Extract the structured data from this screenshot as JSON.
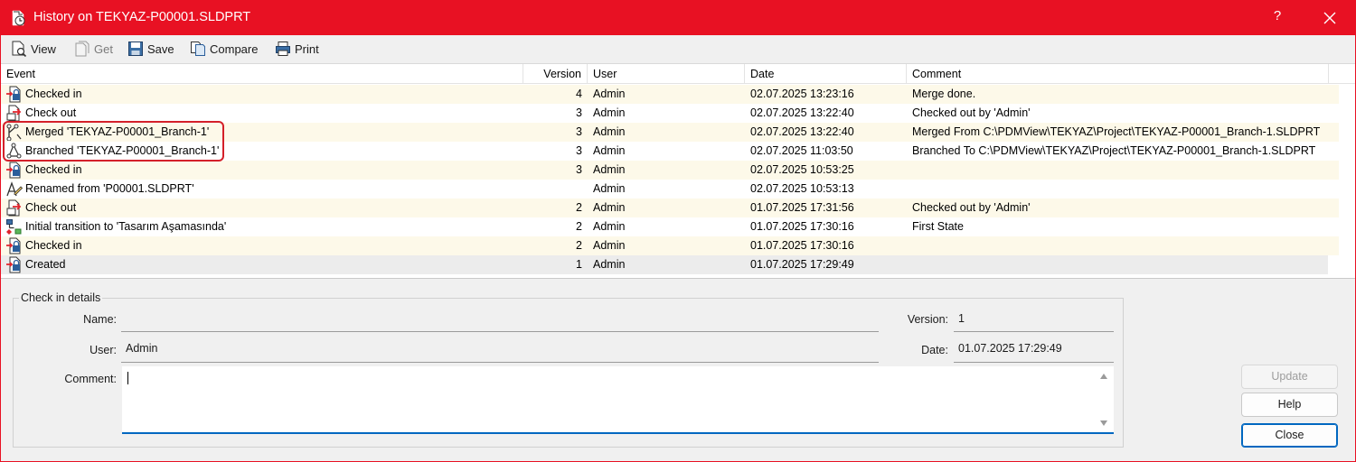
{
  "window": {
    "title": "History on TEKYAZ-P00001.SLDPRT",
    "help_label": "?",
    "accent_color": "#e81123"
  },
  "toolbar": {
    "view": "View",
    "get": "Get",
    "save": "Save",
    "compare": "Compare",
    "print": "Print"
  },
  "grid": {
    "columns": [
      "Event",
      "Version",
      "User",
      "Date",
      "Comment"
    ],
    "rows": [
      {
        "icon": "checked-in-icon",
        "event": "Checked in",
        "version": "4",
        "user": "Admin",
        "date": "02.07.2025 13:23:16",
        "comment": "Merge done."
      },
      {
        "icon": "check-out-icon",
        "event": "Check out",
        "version": "3",
        "user": "Admin",
        "date": "02.07.2025 13:22:40",
        "comment": "Checked out by 'Admin'"
      },
      {
        "icon": "merge-icon",
        "event": "Merged 'TEKYAZ-P00001_Branch-1'",
        "version": "3",
        "user": "Admin",
        "date": "02.07.2025 13:22:40",
        "comment": "Merged From C:\\PDMView\\TEKYAZ\\Project\\TEKYAZ-P00001_Branch-1.SLDPRT"
      },
      {
        "icon": "branch-icon",
        "event": "Branched 'TEKYAZ-P00001_Branch-1'",
        "version": "3",
        "user": "Admin",
        "date": "02.07.2025 11:03:50",
        "comment": "Branched To C:\\PDMView\\TEKYAZ\\Project\\TEKYAZ-P00001_Branch-1.SLDPRT"
      },
      {
        "icon": "checked-in-icon",
        "event": "Checked in",
        "version": "3",
        "user": "Admin",
        "date": "02.07.2025 10:53:25",
        "comment": ""
      },
      {
        "icon": "rename-icon",
        "event": "Renamed from 'P00001.SLDPRT'",
        "version": "",
        "user": "Admin",
        "date": "02.07.2025 10:53:13",
        "comment": ""
      },
      {
        "icon": "check-out-icon",
        "event": "Check out",
        "version": "2",
        "user": "Admin",
        "date": "01.07.2025 17:31:56",
        "comment": "Checked out by 'Admin'"
      },
      {
        "icon": "workflow-transition-icon",
        "event": "Initial transition to 'Tasarım Aşamasında'",
        "version": "2",
        "user": "Admin",
        "date": "01.07.2025 17:30:16",
        "comment": "First State"
      },
      {
        "icon": "checked-in-icon",
        "event": "Checked in",
        "version": "2",
        "user": "Admin",
        "date": "01.07.2025 17:30:16",
        "comment": ""
      },
      {
        "icon": "created-icon",
        "event": "Created",
        "version": "1",
        "user": "Admin",
        "date": "01.07.2025 17:29:49",
        "comment": ""
      }
    ]
  },
  "details": {
    "legend": "Check in details",
    "name_label": "Name:",
    "name_value": "",
    "version_label": "Version:",
    "version_value": "1",
    "user_label": "User:",
    "user_value": "Admin",
    "date_label": "Date:",
    "date_value": "01.07.2025 17:29:49",
    "comment_label": "Comment:",
    "comment_value": ""
  },
  "buttons": {
    "update": "Update",
    "help": "Help",
    "close": "Close"
  }
}
